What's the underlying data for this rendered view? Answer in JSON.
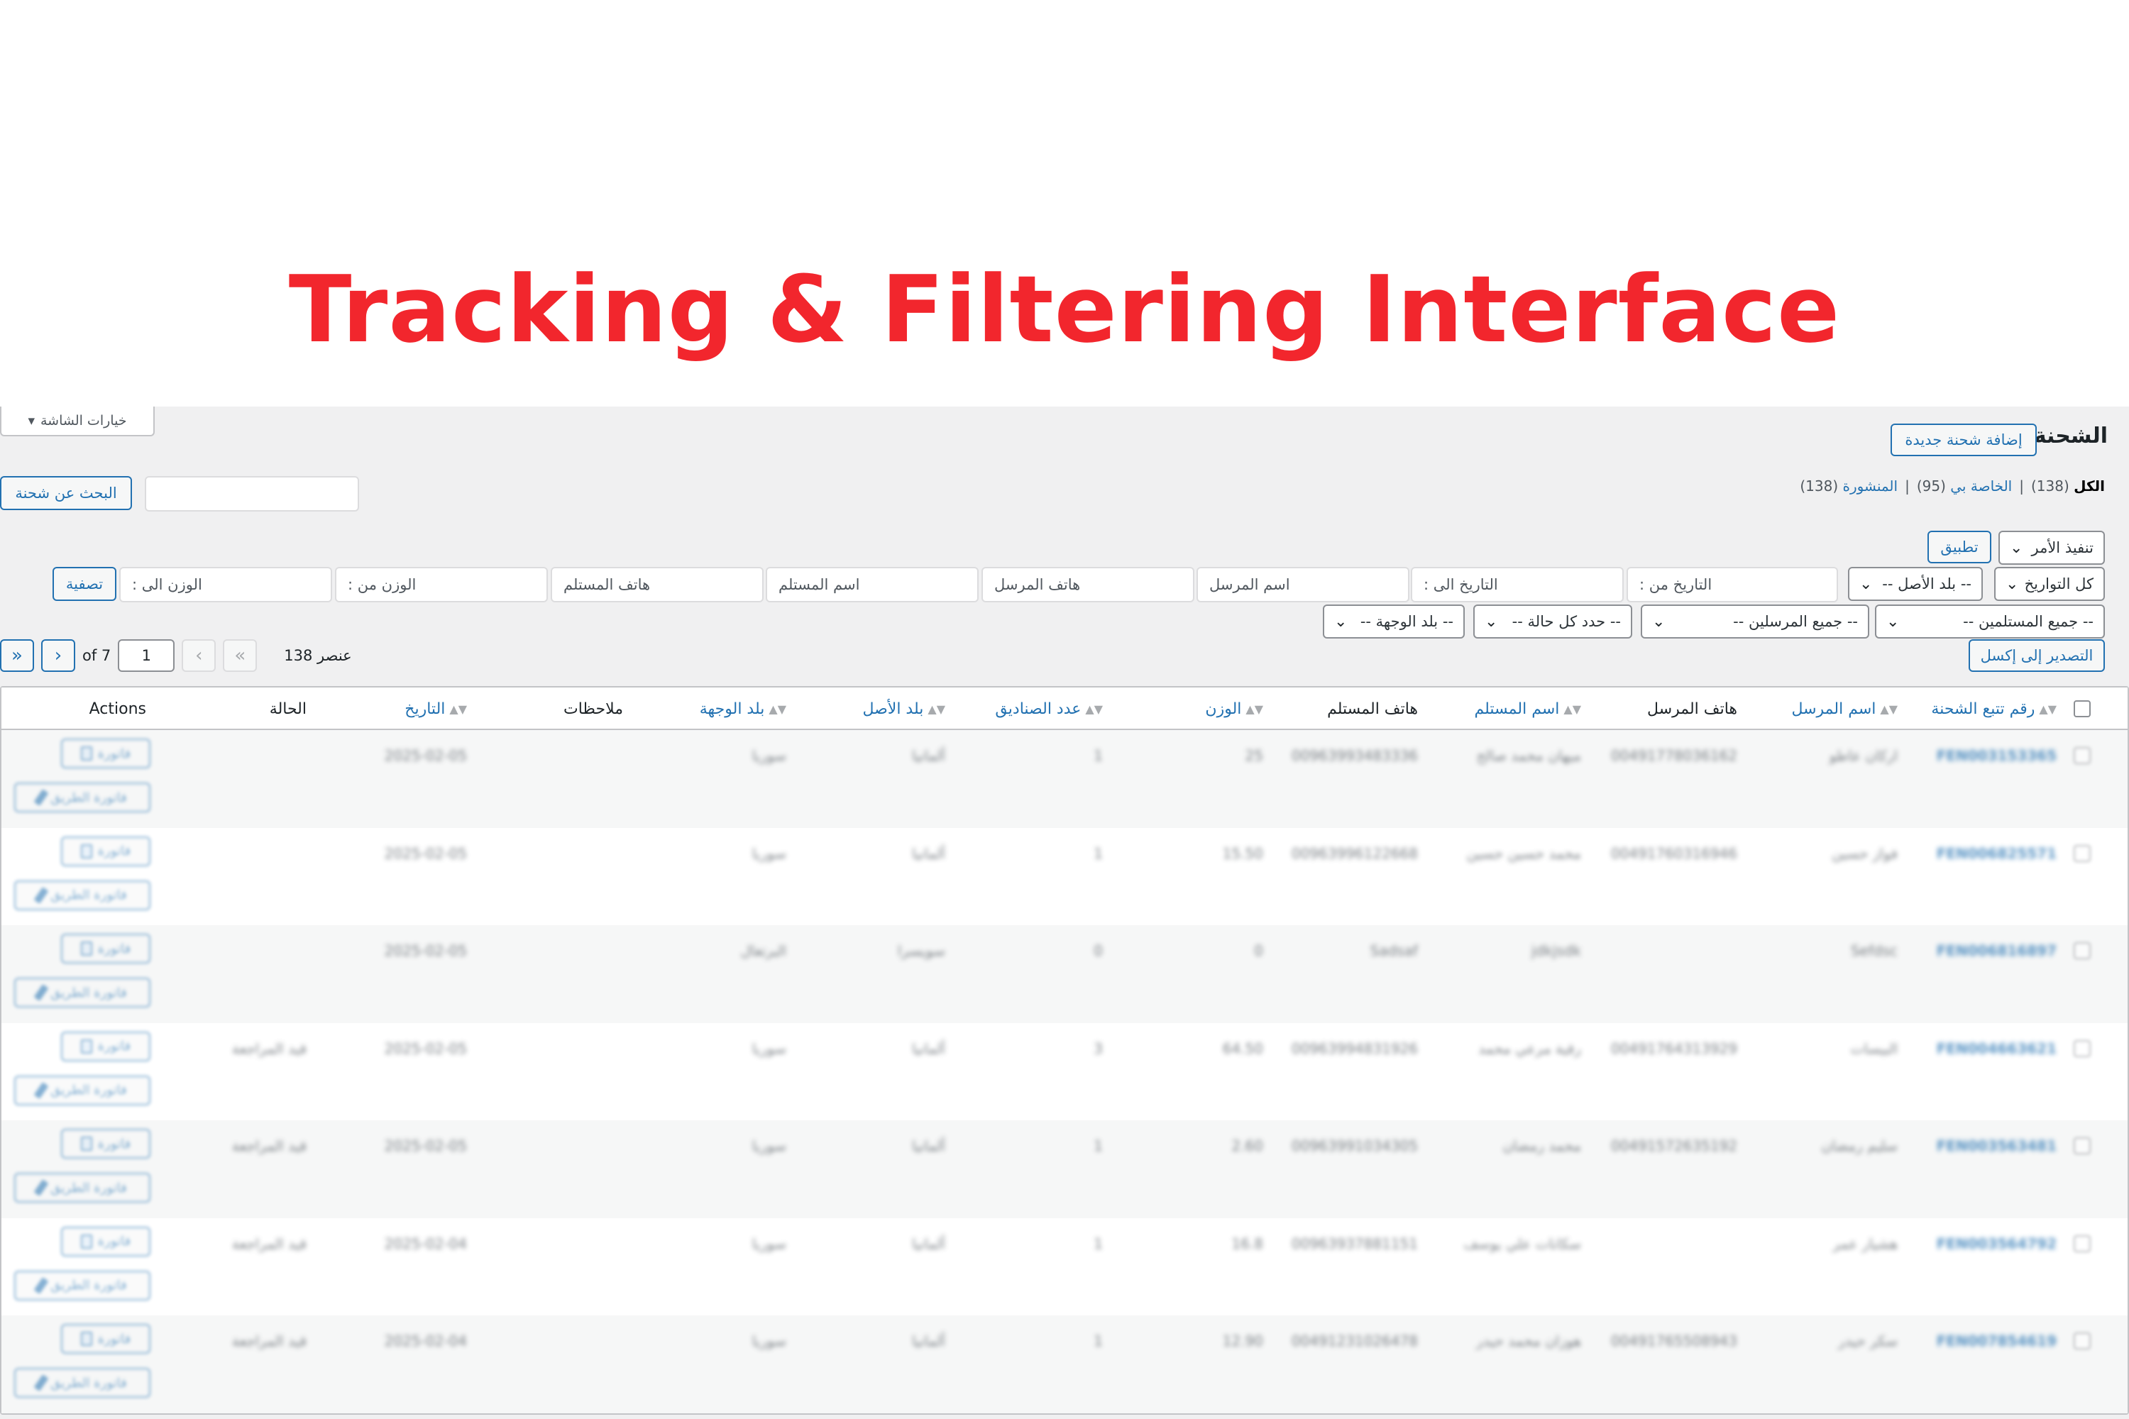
{
  "hero_title": "Tracking & Filtering Interface",
  "screen_options": "خيارات الشاشة",
  "page_title": "الشحنة",
  "add_new": "إضافة شحنة جديدة",
  "views": {
    "all": "الكل",
    "all_count": "(138)",
    "mine": "الخاصة بي",
    "mine_count": "(95)",
    "published": "المنشورة",
    "published_count": "(138)",
    "sep": "|"
  },
  "search": {
    "button": "البحث عن شحنة",
    "placeholder": ""
  },
  "bulk": {
    "select": "تنفيذ الأمر",
    "apply": "تطبيق"
  },
  "filters": {
    "dates": "كل التواريخ",
    "origin": "-- بلد الأصل --",
    "date_from": "التاريخ من :",
    "date_to": "التاريخ الى :",
    "sender_name": "اسم المرسل",
    "sender_phone": "هاتف المرسل",
    "recipient_name": "اسم المستلم",
    "recipient_phone": "هاتف المستلم",
    "weight_from": "الوزن من :",
    "weight_to": "الوزن الى :",
    "filter_button": "تصفية",
    "recipients": "-- جميع المستلمين --",
    "senders": "-- جميع المرسلين --",
    "status": "-- حدد كل حالة --",
    "destination": "-- بلد الوجهة --"
  },
  "export": "التصدير إلى إكسل",
  "pagination": {
    "items": "138 عنصر",
    "first": "«",
    "prev": "‹",
    "current": "1",
    "of": "of 7",
    "next": "›",
    "last": "»"
  },
  "columns": {
    "tracking": "رقم تتبع الشحنة",
    "sender_name": "اسم المرسل",
    "sender_phone": "هاتف المرسل",
    "recipient_name": "اسم المستلم",
    "recipient_phone": "هاتف المستلم",
    "weight": "الوزن",
    "boxes": "عدد الصناديق",
    "origin": "بلد الأصل",
    "destination": "بلد الوجهة",
    "notes": "ملاحظات",
    "date": "التاريخ",
    "status": "الحالة",
    "actions": "Actions"
  },
  "actions": {
    "invoice": "فاتورة",
    "waybill": "فاتورة الطريق"
  },
  "rows": [
    {
      "tracking": "FEN003153365",
      "sender": "اركان عاطو",
      "sender_phone": "00491778036162",
      "recipient": "ميهان محمد صالح",
      "recipient_phone": "00963993483336",
      "weight": "25",
      "boxes": "1",
      "origin": "ألمانيا",
      "destination": "سوريا",
      "date": "2025-02-05",
      "status": ""
    },
    {
      "tracking": "FEN006825571",
      "sender": "فواز حسين",
      "sender_phone": "00491760316946",
      "recipient": "محمد حسين حسين",
      "recipient_phone": "00963996122668",
      "weight": "15.50",
      "boxes": "1",
      "origin": "ألمانيا",
      "destination": "سوريا",
      "date": "2025-02-05",
      "status": ""
    },
    {
      "tracking": "FEN006816897",
      "sender": "Sefdsc",
      "sender_phone": "",
      "recipient": "jdkjsdk",
      "recipient_phone": "Sadsaf",
      "weight": "0",
      "boxes": "0",
      "origin": "سويسرا",
      "destination": "البرتغال",
      "date": "2025-02-05",
      "status": ""
    },
    {
      "tracking": "FEN004663621",
      "sender": "البيسات",
      "sender_phone": "00491764313929",
      "recipient": "رقية مرعي محمد",
      "recipient_phone": "00963994831926",
      "weight": "64.50",
      "boxes": "3",
      "origin": "ألمانيا",
      "destination": "سوريا",
      "date": "2025-02-05",
      "status": "قيد المراجعة"
    },
    {
      "tracking": "FEN003563481",
      "sender": "سليم رمضان",
      "sender_phone": "00491572635192",
      "recipient": "محمد رمضان",
      "recipient_phone": "00963991034305",
      "weight": "2.60",
      "boxes": "1",
      "origin": "ألمانيا",
      "destination": "سوريا",
      "date": "2025-02-05",
      "status": "قيد المراجعة"
    },
    {
      "tracking": "FEN003564792",
      "sender": "هشيار عمر",
      "sender_phone": "",
      "recipient": "سكانات علي يوسف",
      "recipient_phone": "00963937881151",
      "weight": "16.8",
      "boxes": "1",
      "origin": "ألمانيا",
      "destination": "سوريا",
      "date": "2025-02-04",
      "status": "قيد المراجعة"
    },
    {
      "tracking": "FEN007854619",
      "sender": "سكر حيدر",
      "sender_phone": "00491765508943",
      "recipient": "هوزان محمد حيدر",
      "recipient_phone": "00491231026478",
      "weight": "12.90",
      "boxes": "1",
      "origin": "ألمانيا",
      "destination": "سوريا",
      "date": "2025-02-04",
      "status": "قيد المراجعة"
    }
  ]
}
